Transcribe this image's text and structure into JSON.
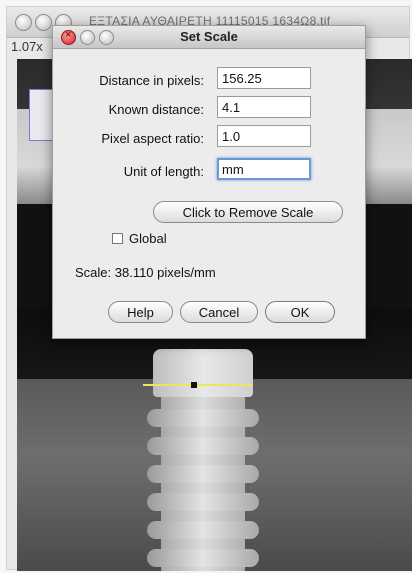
{
  "background_window": {
    "title": "ΕΞΤΑΣΙΑ ΑΥΘΑΙΡΕΤΗ 11115015 1634Ω8.tif",
    "zoom": "1.07x"
  },
  "dialog": {
    "title": "Set Scale",
    "fields": [
      {
        "label": "Distance in pixels:",
        "value": "156.25"
      },
      {
        "label": "Known distance:",
        "value": "4.1"
      },
      {
        "label": "Pixel aspect ratio:",
        "value": "1.0"
      },
      {
        "label": "Unit of length:",
        "value": "mm"
      }
    ],
    "remove_scale_label": "Click to Remove Scale",
    "global_label": "Global",
    "global_checked": false,
    "scale_text": "Scale: 38.110 pixels/mm",
    "buttons": {
      "help": "Help",
      "cancel": "Cancel",
      "ok": "OK"
    }
  },
  "colors": {
    "measurement_line": "#e8e85a",
    "focus_ring": "#6b98d8",
    "close_button": "#d22121"
  },
  "icons": [
    "close-icon",
    "minimize-icon",
    "zoom-icon"
  ]
}
